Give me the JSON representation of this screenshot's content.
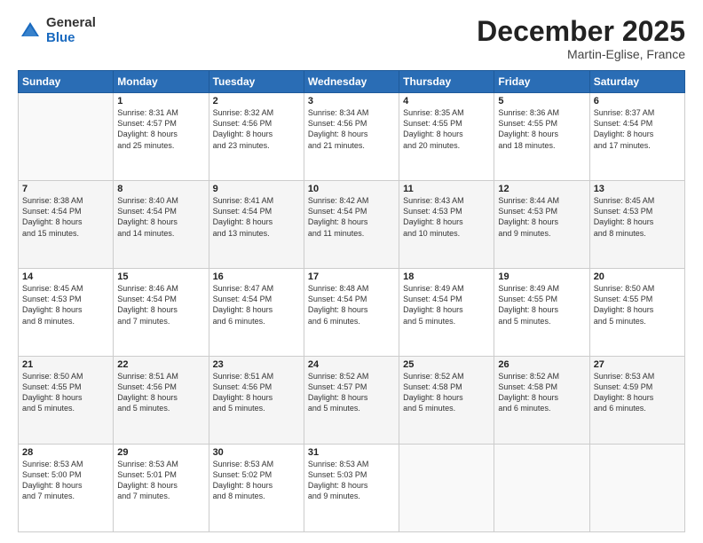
{
  "header": {
    "logo_general": "General",
    "logo_blue": "Blue",
    "month_title": "December 2025",
    "location": "Martin-Eglise, France"
  },
  "days_of_week": [
    "Sunday",
    "Monday",
    "Tuesday",
    "Wednesday",
    "Thursday",
    "Friday",
    "Saturday"
  ],
  "weeks": [
    [
      {
        "day": "",
        "content": ""
      },
      {
        "day": "1",
        "content": "Sunrise: 8:31 AM\nSunset: 4:57 PM\nDaylight: 8 hours\nand 25 minutes."
      },
      {
        "day": "2",
        "content": "Sunrise: 8:32 AM\nSunset: 4:56 PM\nDaylight: 8 hours\nand 23 minutes."
      },
      {
        "day": "3",
        "content": "Sunrise: 8:34 AM\nSunset: 4:56 PM\nDaylight: 8 hours\nand 21 minutes."
      },
      {
        "day": "4",
        "content": "Sunrise: 8:35 AM\nSunset: 4:55 PM\nDaylight: 8 hours\nand 20 minutes."
      },
      {
        "day": "5",
        "content": "Sunrise: 8:36 AM\nSunset: 4:55 PM\nDaylight: 8 hours\nand 18 minutes."
      },
      {
        "day": "6",
        "content": "Sunrise: 8:37 AM\nSunset: 4:54 PM\nDaylight: 8 hours\nand 17 minutes."
      }
    ],
    [
      {
        "day": "7",
        "content": "Sunrise: 8:38 AM\nSunset: 4:54 PM\nDaylight: 8 hours\nand 15 minutes."
      },
      {
        "day": "8",
        "content": "Sunrise: 8:40 AM\nSunset: 4:54 PM\nDaylight: 8 hours\nand 14 minutes."
      },
      {
        "day": "9",
        "content": "Sunrise: 8:41 AM\nSunset: 4:54 PM\nDaylight: 8 hours\nand 13 minutes."
      },
      {
        "day": "10",
        "content": "Sunrise: 8:42 AM\nSunset: 4:54 PM\nDaylight: 8 hours\nand 11 minutes."
      },
      {
        "day": "11",
        "content": "Sunrise: 8:43 AM\nSunset: 4:53 PM\nDaylight: 8 hours\nand 10 minutes."
      },
      {
        "day": "12",
        "content": "Sunrise: 8:44 AM\nSunset: 4:53 PM\nDaylight: 8 hours\nand 9 minutes."
      },
      {
        "day": "13",
        "content": "Sunrise: 8:45 AM\nSunset: 4:53 PM\nDaylight: 8 hours\nand 8 minutes."
      }
    ],
    [
      {
        "day": "14",
        "content": "Sunrise: 8:45 AM\nSunset: 4:53 PM\nDaylight: 8 hours\nand 8 minutes."
      },
      {
        "day": "15",
        "content": "Sunrise: 8:46 AM\nSunset: 4:54 PM\nDaylight: 8 hours\nand 7 minutes."
      },
      {
        "day": "16",
        "content": "Sunrise: 8:47 AM\nSunset: 4:54 PM\nDaylight: 8 hours\nand 6 minutes."
      },
      {
        "day": "17",
        "content": "Sunrise: 8:48 AM\nSunset: 4:54 PM\nDaylight: 8 hours\nand 6 minutes."
      },
      {
        "day": "18",
        "content": "Sunrise: 8:49 AM\nSunset: 4:54 PM\nDaylight: 8 hours\nand 5 minutes."
      },
      {
        "day": "19",
        "content": "Sunrise: 8:49 AM\nSunset: 4:55 PM\nDaylight: 8 hours\nand 5 minutes."
      },
      {
        "day": "20",
        "content": "Sunrise: 8:50 AM\nSunset: 4:55 PM\nDaylight: 8 hours\nand 5 minutes."
      }
    ],
    [
      {
        "day": "21",
        "content": "Sunrise: 8:50 AM\nSunset: 4:55 PM\nDaylight: 8 hours\nand 5 minutes."
      },
      {
        "day": "22",
        "content": "Sunrise: 8:51 AM\nSunset: 4:56 PM\nDaylight: 8 hours\nand 5 minutes."
      },
      {
        "day": "23",
        "content": "Sunrise: 8:51 AM\nSunset: 4:56 PM\nDaylight: 8 hours\nand 5 minutes."
      },
      {
        "day": "24",
        "content": "Sunrise: 8:52 AM\nSunset: 4:57 PM\nDaylight: 8 hours\nand 5 minutes."
      },
      {
        "day": "25",
        "content": "Sunrise: 8:52 AM\nSunset: 4:58 PM\nDaylight: 8 hours\nand 5 minutes."
      },
      {
        "day": "26",
        "content": "Sunrise: 8:52 AM\nSunset: 4:58 PM\nDaylight: 8 hours\nand 6 minutes."
      },
      {
        "day": "27",
        "content": "Sunrise: 8:53 AM\nSunset: 4:59 PM\nDaylight: 8 hours\nand 6 minutes."
      }
    ],
    [
      {
        "day": "28",
        "content": "Sunrise: 8:53 AM\nSunset: 5:00 PM\nDaylight: 8 hours\nand 7 minutes."
      },
      {
        "day": "29",
        "content": "Sunrise: 8:53 AM\nSunset: 5:01 PM\nDaylight: 8 hours\nand 7 minutes."
      },
      {
        "day": "30",
        "content": "Sunrise: 8:53 AM\nSunset: 5:02 PM\nDaylight: 8 hours\nand 8 minutes."
      },
      {
        "day": "31",
        "content": "Sunrise: 8:53 AM\nSunset: 5:03 PM\nDaylight: 8 hours\nand 9 minutes."
      },
      {
        "day": "",
        "content": ""
      },
      {
        "day": "",
        "content": ""
      },
      {
        "day": "",
        "content": ""
      }
    ]
  ]
}
